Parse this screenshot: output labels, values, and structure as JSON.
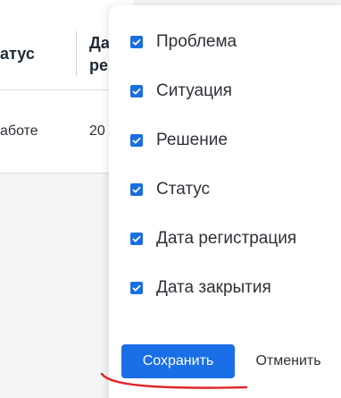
{
  "table": {
    "headers": [
      "атус",
      "Да ре"
    ],
    "header_status": "атус",
    "header_date_line1": "Да",
    "header_date_line2": "ре",
    "row": {
      "status": "аботе",
      "date": "20"
    }
  },
  "popup": {
    "options": [
      {
        "label": "Проблема",
        "checked": true
      },
      {
        "label": "Ситуация",
        "checked": true
      },
      {
        "label": "Решение",
        "checked": true
      },
      {
        "label": "Статус",
        "checked": true
      },
      {
        "label": "Дата регистрация",
        "checked": true
      },
      {
        "label": "Дата закрытия",
        "checked": true
      }
    ],
    "save_label": "Сохранить",
    "cancel_label": "Отменить"
  },
  "colors": {
    "accent": "#1a6fe6",
    "annotation": "#e0262a"
  }
}
